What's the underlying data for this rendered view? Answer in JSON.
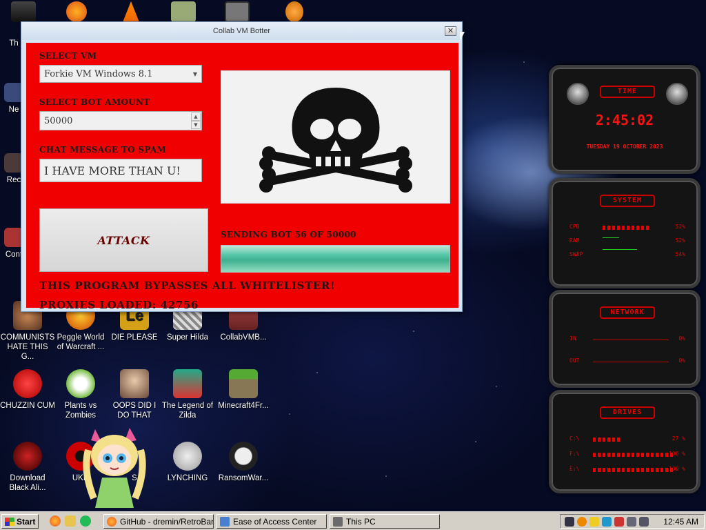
{
  "desktop": {
    "top_icons_partial": [
      "Th",
      "Ne",
      "Rec",
      "Cont"
    ],
    "icons": [
      {
        "label": "COMMUNISTS HATE THIS G...",
        "icon": "game-icon"
      },
      {
        "label": "Peggle World of Warcraft ...",
        "icon": "peggle-icon"
      },
      {
        "label": "DIE PLEASE",
        "icon": "le-icon"
      },
      {
        "label": "Super Hilda",
        "icon": "pixel-icon"
      },
      {
        "label": "CollabVMB...",
        "icon": "app-icon"
      },
      {
        "label": "CHUZZIN CUM",
        "icon": "chuzzle-icon"
      },
      {
        "label": "Plants vs Zombies",
        "icon": "flower-icon"
      },
      {
        "label": "OOPS DID I DO THAT",
        "icon": "portrait-icon"
      },
      {
        "label": "The Legend of Zilda",
        "icon": "hero-icon"
      },
      {
        "label": "Minecraft4Fr...",
        "icon": "grass-block-icon"
      },
      {
        "label": "Download Black Ali...",
        "icon": "alien-icon"
      },
      {
        "label": "UKR",
        "icon": "radiation-icon"
      },
      {
        "label": "S",
        "icon": "character-icon"
      },
      {
        "label": "LYNCHING",
        "icon": "vpn-icon"
      },
      {
        "label": "RansomWar...",
        "icon": "skull-icon"
      }
    ]
  },
  "window": {
    "title": "Collab VM Botter",
    "close_glyph": "✕",
    "select_vm_label": "SELECT VM",
    "select_vm_value": "Forkie VM Windows 8.1",
    "select_bot_label": "SELECT BOT AMOUNT",
    "bot_amount_value": "50000",
    "chat_label": "CHAT MESSAGE TO SPAM",
    "chat_value": "I HAVE MORE THAN U!",
    "attack_label": "ATTACK",
    "status_text": "SENDING BOT 56 OF 50000",
    "progress_fraction": 1.0,
    "bypass_text": "THIS PROGRAM BYPASSES ALL WHITELISTER!",
    "proxies_text": "PROXIES LOADED: 42756",
    "accent_color": "#f00000"
  },
  "gadgets": {
    "time": {
      "header": "TIME",
      "clock": "2:45:02",
      "date": "TUESDAY 19 OCTOBER 2023"
    },
    "system": {
      "header": "SYSTEM",
      "rows": [
        {
          "label": "CPU",
          "value": "52%",
          "fraction": 0.52
        },
        {
          "label": "RAM",
          "value": "52%",
          "fraction": 0.52
        },
        {
          "label": "SWAP",
          "value": "54%",
          "fraction": 0.54
        }
      ]
    },
    "network": {
      "header": "NETWORK",
      "rows": [
        {
          "label": "IN",
          "value": "0%"
        },
        {
          "label": "OUT",
          "value": "0%"
        }
      ]
    },
    "drives": {
      "header": "DRIVES",
      "rows": [
        {
          "label": "C:\\",
          "value": "27 %",
          "fraction": 0.27
        },
        {
          "label": "F:\\",
          "value": "100 %",
          "fraction": 1.0
        },
        {
          "label": "E:\\",
          "value": "100 %",
          "fraction": 1.0
        }
      ]
    }
  },
  "taskbar": {
    "start_label": "Start",
    "tasks": [
      {
        "label": "GitHub - dremin/RetroBar...",
        "icon": "firefox-icon"
      },
      {
        "label": "Ease of Access Center",
        "icon": "control-panel-icon"
      },
      {
        "label": "This PC",
        "icon": "computer-icon"
      }
    ],
    "clock": "12:45 AM"
  }
}
